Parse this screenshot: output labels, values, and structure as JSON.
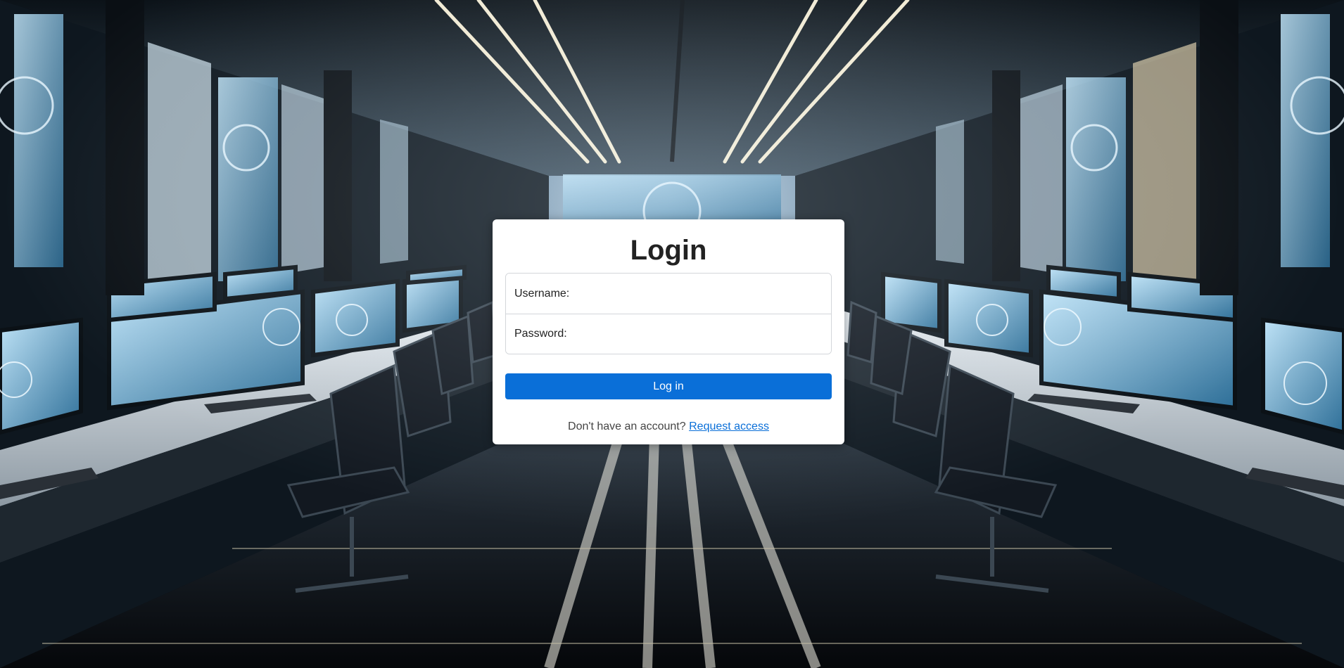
{
  "login": {
    "title": "Login",
    "username_label": "Username:",
    "username_value": "",
    "password_label": "Password:",
    "password_value": "",
    "submit_label": "Log in",
    "signup_prompt": "Don't have an account?",
    "signup_link": "Request access"
  },
  "theme": {
    "accent": "#0a6fd8",
    "card_background": "#ffffff",
    "text": "#222222"
  },
  "background": {
    "scene": "futuristic control room with rows of desks, monitors and chairs",
    "icon": "background-image"
  }
}
